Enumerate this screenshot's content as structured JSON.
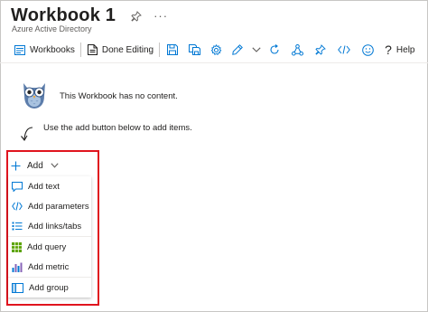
{
  "header": {
    "title": "Workbook 1",
    "subtitle": "Azure Active Directory",
    "more_label": "···"
  },
  "toolbar": {
    "workbooks_label": "Workbooks",
    "done_editing_label": "Done Editing",
    "help_label": "Help"
  },
  "empty_state": {
    "message": "This Workbook has no content.",
    "hint": "Use the add button below to add items."
  },
  "add_menu": {
    "button_label": "Add",
    "items": [
      {
        "label": "Add text",
        "icon": "text-box-icon"
      },
      {
        "label": "Add parameters",
        "icon": "code-icon"
      },
      {
        "label": "Add links/tabs",
        "icon": "bulleted-list-icon"
      },
      {
        "label": "Add query",
        "icon": "grid-icon"
      },
      {
        "label": "Add metric",
        "icon": "bar-chart-icon"
      },
      {
        "label": "Add group",
        "icon": "group-box-icon"
      }
    ]
  },
  "colors": {
    "accent": "#0078d4",
    "highlight_border": "#e0141e",
    "query_green": "#5ba300",
    "text": "#201f1e"
  }
}
